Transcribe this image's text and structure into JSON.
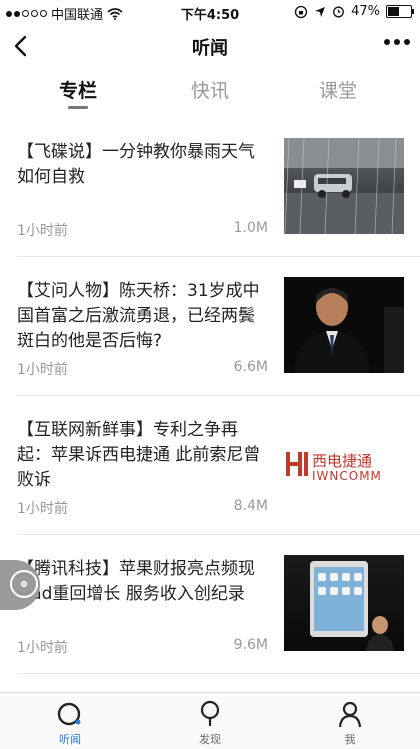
{
  "status_bar": {
    "carrier": "中国联通",
    "time": "下午4:50",
    "battery": "47%",
    "battery_level": 0.47
  },
  "navbar": {
    "title": "听闻"
  },
  "tabs": [
    {
      "label": "专栏",
      "active": true
    },
    {
      "label": "快讯",
      "active": false
    },
    {
      "label": "课堂",
      "active": false
    }
  ],
  "articles": [
    {
      "title": "【飞碟说】一分钟教你暴雨天气如何自救",
      "time": "1小时前",
      "size": "1.0M",
      "image": "rainy-street-photo"
    },
    {
      "title": "【艾问人物】陈天桥：31岁成中国首富之后激流勇退，已经两鬓斑白的他是否后悔?",
      "time": "1小时前",
      "size": "6.6M",
      "image": "man-portrait-photo"
    },
    {
      "title": "【互联网新鲜事】专利之争再起：苹果诉西电捷通 此前索尼曾败诉",
      "time": "1小时前",
      "size": "8.4M",
      "image": "iwncomm-logo",
      "logo_cn": "西电捷通",
      "logo_en": "IWNCOMM"
    },
    {
      "title": "【腾讯科技】苹果财报亮点频现 iPad重回增长 服务收入创纪录",
      "time": "1小时前",
      "size": "9.6M",
      "image": "ipad-keynote-photo"
    }
  ],
  "tabbar": [
    {
      "label": "听闻",
      "icon": "listen-icon",
      "active": true
    },
    {
      "label": "发现",
      "icon": "discover-icon",
      "active": false
    },
    {
      "label": "我",
      "icon": "profile-icon",
      "active": false
    }
  ],
  "colors": {
    "accent": "#2b7cd8",
    "logo_red": "#c0392b"
  }
}
